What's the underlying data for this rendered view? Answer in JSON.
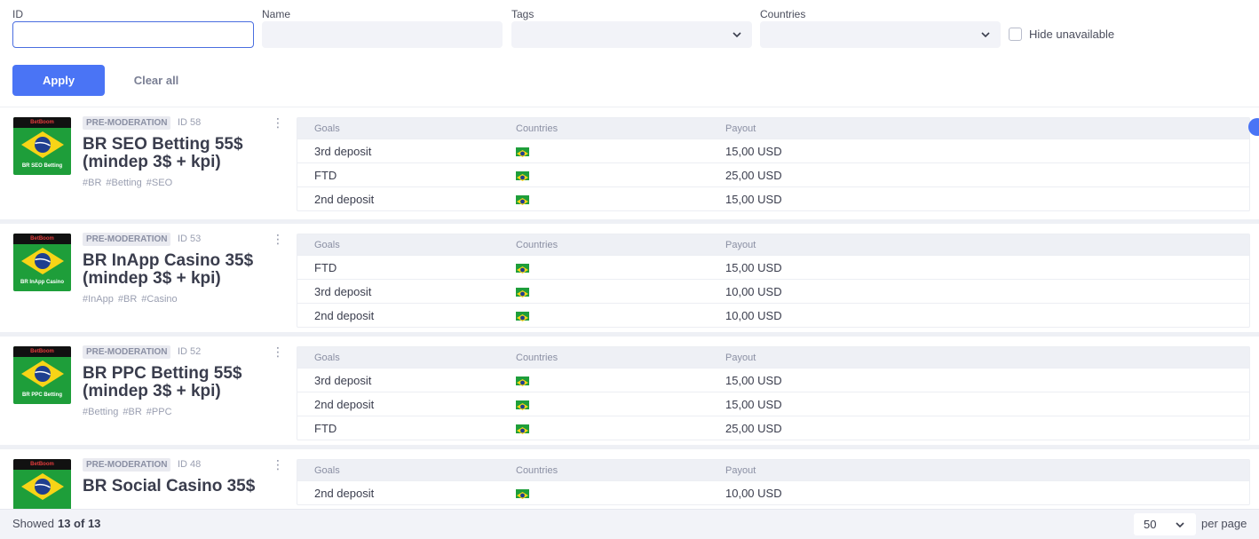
{
  "filters": {
    "id_label": "ID",
    "name_label": "Name",
    "tags_label": "Tags",
    "countries_label": "Countries",
    "hide_unavailable_label": "Hide unavailable",
    "apply_label": "Apply",
    "clear_label": "Clear all"
  },
  "table_headers": {
    "goals": "Goals",
    "countries": "Countries",
    "payout": "Payout"
  },
  "status_label": "PRE-MODERATION",
  "offers": [
    {
      "id": "ID 58",
      "brand": "BetBoom",
      "logo_caption": "BR SEO Betting",
      "title": "BR SEO Betting 55$ (mindep 3$ + kpi)",
      "tags": [
        "#BR",
        "#Betting",
        "#SEO"
      ],
      "goals": [
        {
          "goal": "3rd deposit",
          "payout": "15,00 USD"
        },
        {
          "goal": "FTD",
          "payout": "25,00 USD"
        },
        {
          "goal": "2nd deposit",
          "payout": "15,00 USD"
        }
      ]
    },
    {
      "id": "ID 53",
      "brand": "BetBoom",
      "logo_caption": "BR InApp Casino",
      "title": "BR InApp Casino 35$ (mindep 3$ + kpi)",
      "tags": [
        "#InApp",
        "#BR",
        "#Casino"
      ],
      "goals": [
        {
          "goal": "FTD",
          "payout": "15,00 USD"
        },
        {
          "goal": "3rd deposit",
          "payout": "10,00 USD"
        },
        {
          "goal": "2nd deposit",
          "payout": "10,00 USD"
        }
      ]
    },
    {
      "id": "ID 52",
      "brand": "BetBoom",
      "logo_caption": "BR PPC Betting",
      "title": "BR PPC Betting 55$ (mindep 3$ + kpi)",
      "tags": [
        "#Betting",
        "#BR",
        "#PPC"
      ],
      "goals": [
        {
          "goal": "3rd deposit",
          "payout": "15,00 USD"
        },
        {
          "goal": "2nd deposit",
          "payout": "15,00 USD"
        },
        {
          "goal": "FTD",
          "payout": "25,00 USD"
        }
      ]
    },
    {
      "id": "ID 48",
      "brand": "BetBoom",
      "logo_caption": "",
      "title": "BR Social Casino 35$",
      "tags": [],
      "goals": [
        {
          "goal": "2nd deposit",
          "payout": "10,00 USD"
        }
      ]
    }
  ],
  "footer": {
    "showed_label": "Showed",
    "showed_count": "13 of 13",
    "per_page_value": "50",
    "per_page_label": "per page"
  },
  "colors": {
    "accent": "#4a74f5",
    "flag_green": "#1e9e3a",
    "flag_yellow": "#f7d417",
    "flag_blue": "#1f3f8f"
  }
}
